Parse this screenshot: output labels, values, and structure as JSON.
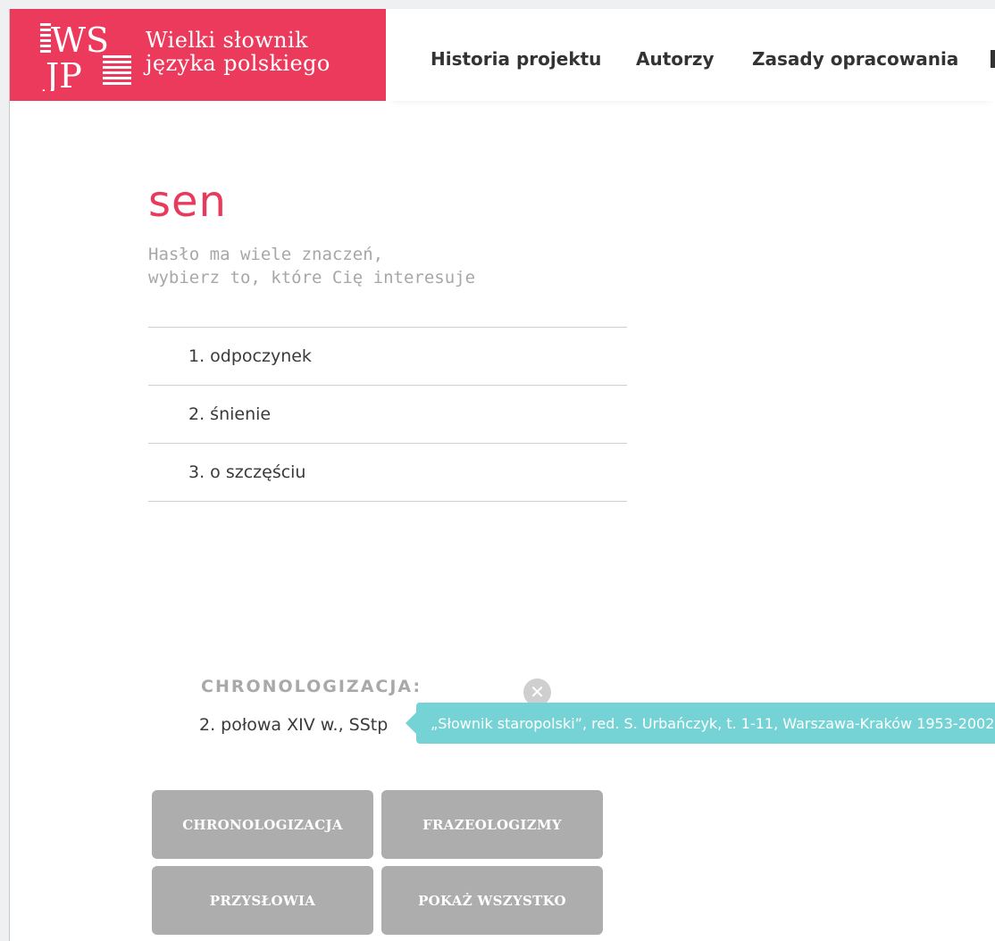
{
  "brand": {
    "logo_letters": "WSJP",
    "title_line1": "Wielki słownik",
    "title_line2": "języka polskiego",
    "color": "#ec3a5c"
  },
  "nav": {
    "items": [
      "Historia projektu",
      "Autorzy",
      "Zasady opracowania"
    ]
  },
  "entry": {
    "headword": "sen",
    "hint_line1": "Hasło ma wiele znaczeń,",
    "hint_line2": "wybierz to, które Cię interesuje",
    "meanings": [
      "1. odpoczynek",
      "2. śnienie",
      "3. o szczęściu"
    ]
  },
  "chronology": {
    "title": "CHRONOLOGIZACJA:",
    "value": "2. połowa XIV w., SStp",
    "close_icon": "close-icon",
    "tooltip": "„Słownik staropolski”, red. S. Urbańczyk, t. 1-11, Warszawa-Kraków 1953-2002.",
    "tooltip_color": "#75d3d6"
  },
  "buttons": {
    "chronologizacja": "CHRONOLOGIZACJA",
    "frazeologizmy": "FRAZEOLOGIZMY",
    "przyslowia": "PRZYSŁOWIA",
    "pokaz_wszystko": "POKAŻ WSZYSTKO"
  }
}
